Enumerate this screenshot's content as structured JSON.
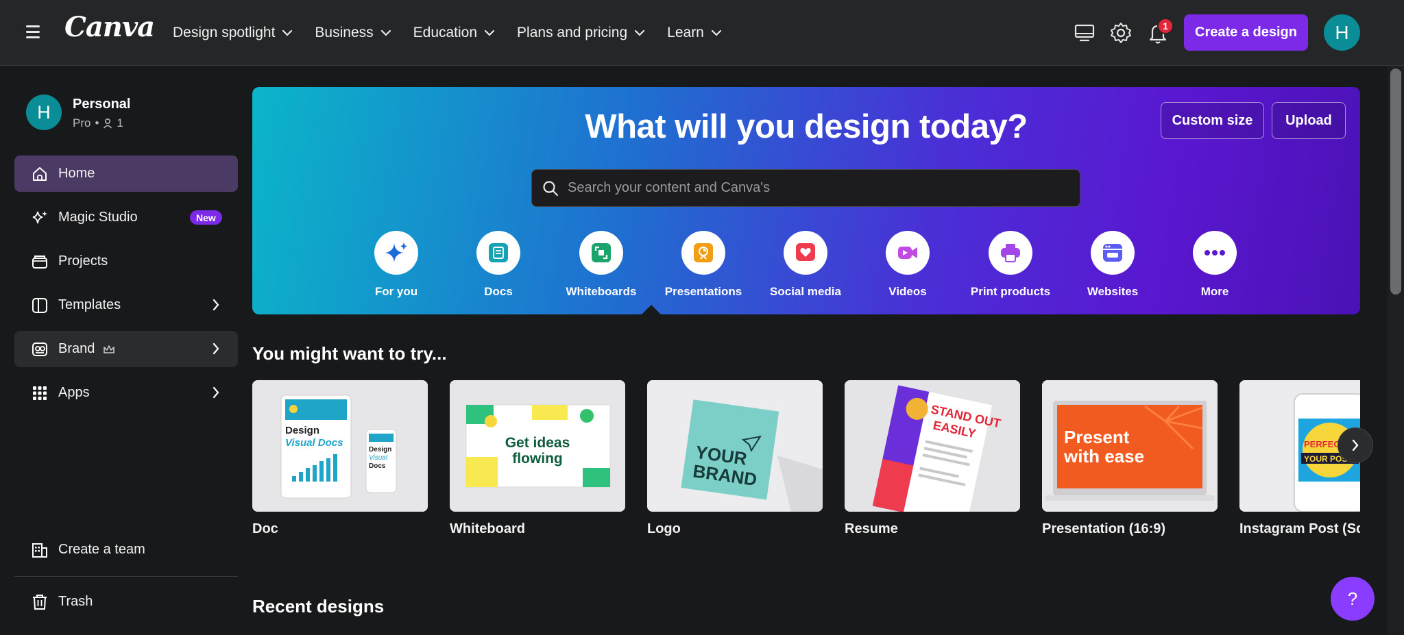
{
  "header": {
    "logo": "Canva",
    "nav": [
      {
        "label": "Design spotlight"
      },
      {
        "label": "Business"
      },
      {
        "label": "Education"
      },
      {
        "label": "Plans and pricing"
      },
      {
        "label": "Learn"
      }
    ],
    "notification_count": "1",
    "create_button": "Create a design",
    "avatar_initial": "H"
  },
  "sidebar": {
    "account": {
      "initial": "H",
      "name": "Personal",
      "plan": "Pro",
      "members": "1"
    },
    "items": [
      {
        "label": "Home",
        "icon": "home-icon",
        "active": true
      },
      {
        "label": "Magic Studio",
        "icon": "sparkle-icon",
        "badge": "New"
      },
      {
        "label": "Projects",
        "icon": "folder-icon"
      },
      {
        "label": "Templates",
        "icon": "templates-icon"
      },
      {
        "label": "Brand",
        "icon": "brand-icon"
      },
      {
        "label": "Apps",
        "icon": "apps-grid-icon"
      }
    ],
    "bottom_items": [
      {
        "label": "Create a team",
        "icon": "team-icon"
      },
      {
        "label": "Trash",
        "icon": "trash-icon"
      }
    ]
  },
  "hero": {
    "title": "What will you design today?",
    "custom_size": "Custom size",
    "upload": "Upload",
    "search_placeholder": "Search your content and Canva's",
    "categories": [
      {
        "label": "For you",
        "icon": "sparkle-icon",
        "color": "#1b6cd8"
      },
      {
        "label": "Docs",
        "icon": "docs-icon",
        "color": "#13a3b5"
      },
      {
        "label": "Whiteboards",
        "icon": "whiteboard-icon",
        "color": "#1aa36a"
      },
      {
        "label": "Presentations",
        "icon": "presentation-icon",
        "color": "#f29e14"
      },
      {
        "label": "Social media",
        "icon": "heart-icon",
        "color": "#ef3b4e"
      },
      {
        "label": "Videos",
        "icon": "video-icon",
        "color": "#c04be0"
      },
      {
        "label": "Print products",
        "icon": "print-icon",
        "color": "#a347e8"
      },
      {
        "label": "Websites",
        "icon": "website-icon",
        "color": "#5b5cf0"
      },
      {
        "label": "More",
        "icon": "more-icon",
        "color": "#5a17d0"
      }
    ]
  },
  "suggestions": {
    "title": "You might want to try...",
    "cards": [
      {
        "label": "Doc",
        "thumb_text": "Design Visual Docs"
      },
      {
        "label": "Whiteboard",
        "thumb_text": "Get ideas flowing"
      },
      {
        "label": "Logo",
        "thumb_text": "YOUR BRAND"
      },
      {
        "label": "Resume",
        "thumb_text": "STAND OUT EASILY"
      },
      {
        "label": "Presentation (16:9)",
        "thumb_text": "Present with ease"
      },
      {
        "label": "Instagram Post (Square)",
        "thumb_text": "PERFECT YOUR POST"
      }
    ]
  },
  "recent": {
    "title": "Recent designs"
  },
  "help_label": "?"
}
